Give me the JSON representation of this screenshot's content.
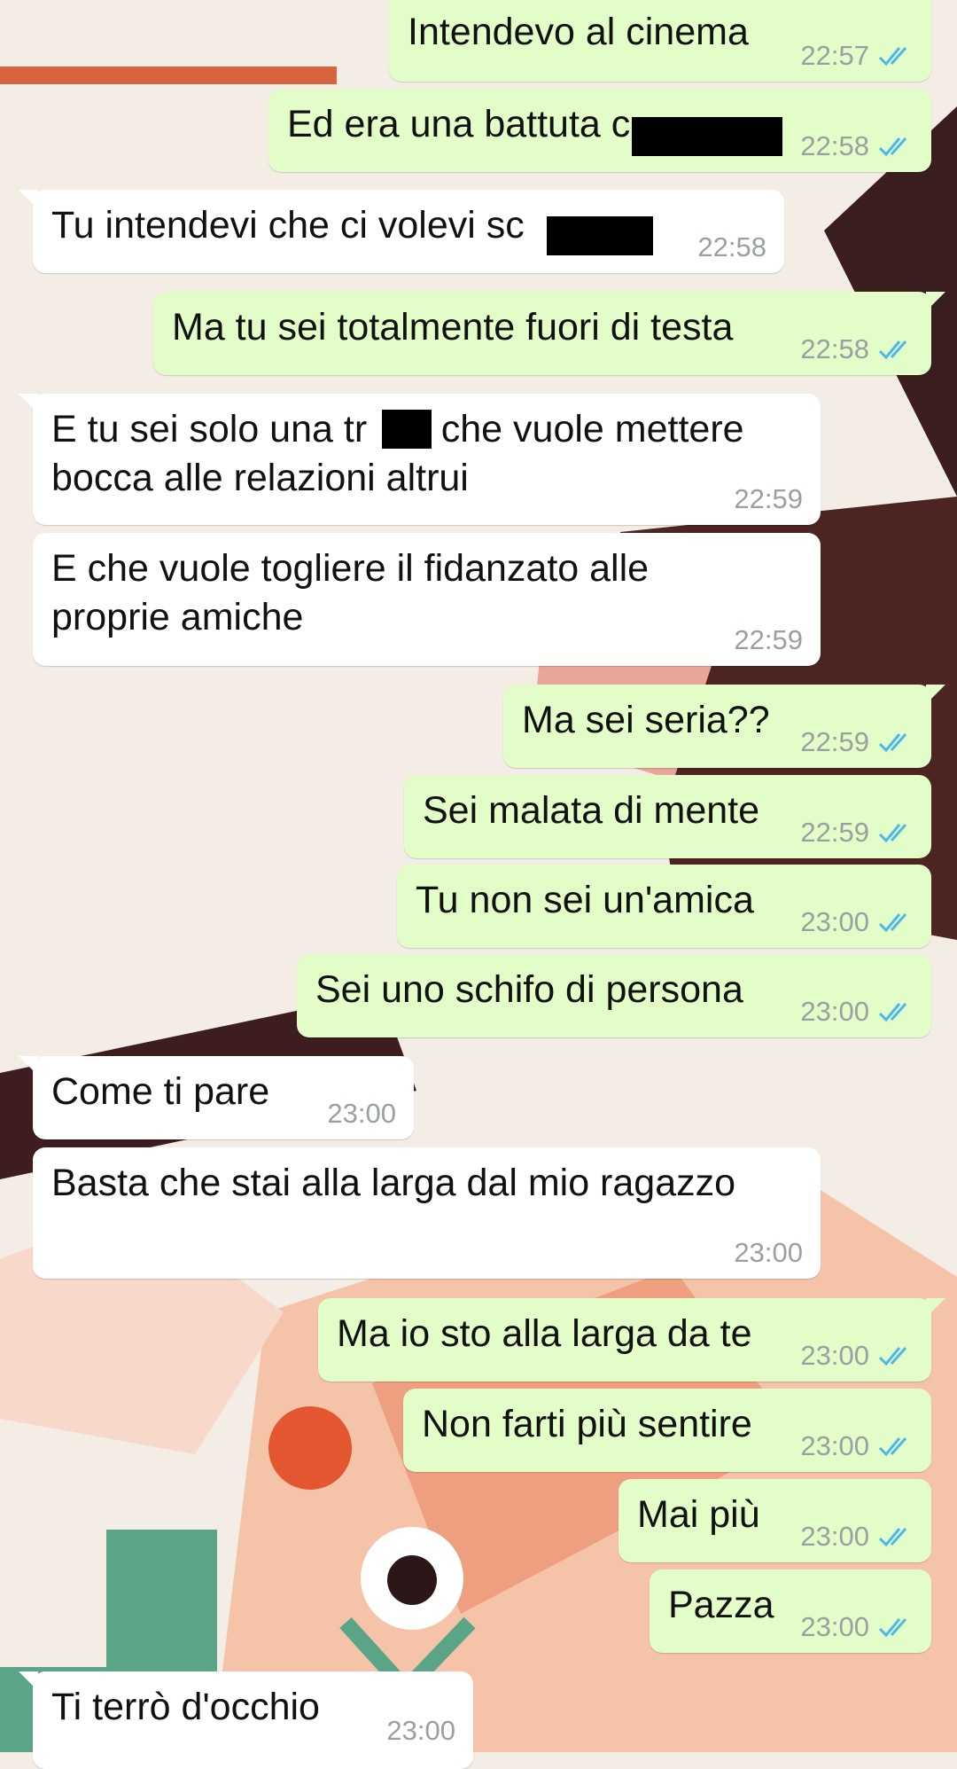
{
  "messages": [
    {
      "dir": "out",
      "text": "Intendevo al cinema",
      "time": "22:57"
    },
    {
      "dir": "out",
      "text": "Ed era una battuta c",
      "time": "22:58"
    },
    {
      "dir": "in",
      "text": "Tu intendevi che ci volevi sc",
      "time": "22:58"
    },
    {
      "dir": "out",
      "text": "Ma tu sei totalmente fuori di testa",
      "time": "22:58"
    },
    {
      "dir": "in",
      "text": "E tu sei solo una tr       che vuole mettere\nbocca alle relazioni altrui",
      "time": "22:59"
    },
    {
      "dir": "in",
      "text": "E che vuole togliere il fidanzato alle\nproprie amiche",
      "time": "22:59"
    },
    {
      "dir": "out",
      "text": "Ma sei seria??",
      "time": "22:59"
    },
    {
      "dir": "out",
      "text": "Sei malata di mente",
      "time": "22:59"
    },
    {
      "dir": "out",
      "text": "Tu non sei un'amica",
      "time": "23:00"
    },
    {
      "dir": "out",
      "text": "Sei uno schifo di persona",
      "time": "23:00"
    },
    {
      "dir": "in",
      "text": "Come ti pare",
      "time": "23:00"
    },
    {
      "dir": "in",
      "text": "Basta che stai alla larga dal mio ragazzo",
      "time": "23:00"
    },
    {
      "dir": "out",
      "text": "Ma io sto alla larga da te",
      "time": "23:00"
    },
    {
      "dir": "out",
      "text": "Non farti più sentire",
      "time": "23:00"
    },
    {
      "dir": "out",
      "text": "Mai più",
      "time": "23:00"
    },
    {
      "dir": "out",
      "text": "Pazza",
      "time": "23:00"
    },
    {
      "dir": "in",
      "text": "Ti terrò d'occhio",
      "time": "23:00"
    }
  ],
  "colors": {
    "outgoing_bubble": "#e2fdc8",
    "incoming_bubble": "#ffffff",
    "read_ticks": "#4fb6ec",
    "timestamp": "#9aa0a2"
  },
  "icons": {
    "read_receipt": "double-check-icon"
  }
}
